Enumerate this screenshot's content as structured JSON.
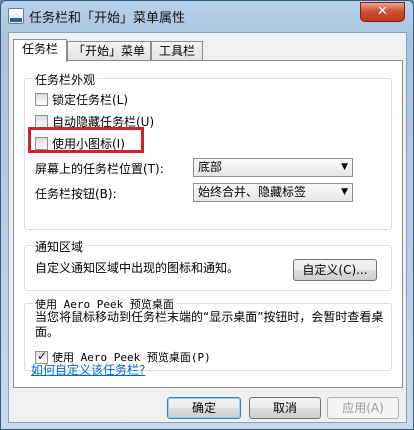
{
  "window": {
    "title": "任务栏和「开始」菜单属性",
    "close_glyph": "✕"
  },
  "tabs": [
    {
      "label": "任务栏",
      "active": true
    },
    {
      "label": "「开始」菜单",
      "active": false
    },
    {
      "label": "工具栏",
      "active": false
    }
  ],
  "appearance": {
    "title": "任务栏外观",
    "lock_taskbar": {
      "label": "锁定任务栏(L)",
      "checked": false
    },
    "auto_hide": {
      "label": "自动隐藏任务栏(U)",
      "checked": false
    },
    "small_icons": {
      "label": "使用小图标(I)",
      "checked": false
    },
    "location": {
      "label": "屏幕上的任务栏位置(T):",
      "value": "底部"
    },
    "buttons": {
      "label": "任务栏按钮(B):",
      "value": "始终合并、隐藏标签"
    }
  },
  "notification": {
    "title": "通知区域",
    "description": "自定义通知区域中出现的图标和通知。",
    "customize_button": "自定义(C)..."
  },
  "aero_peek": {
    "title": "使用 Aero Peek 预览桌面",
    "description": "当您将鼠标移动到任务栏末端的“显示桌面”按钮时，会暂时查看桌面。",
    "checkbox": {
      "label": "使用 Aero Peek 预览桌面(P)",
      "checked": true
    }
  },
  "help_link": "如何自定义该任务栏?",
  "footer": {
    "ok": "确定",
    "cancel": "取消",
    "apply": "应用(A)"
  },
  "colors": {
    "highlight": "#d3202b",
    "link": "#0066cc"
  }
}
